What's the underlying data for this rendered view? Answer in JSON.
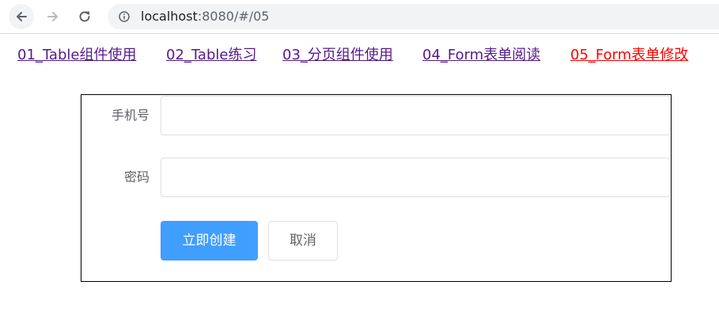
{
  "browser": {
    "url_host": "localhost",
    "url_rest": ":8080/#/05"
  },
  "nav_links": [
    {
      "label": "01_Table组件使用"
    },
    {
      "label": "02_Table练习"
    },
    {
      "label": "03_分页组件使用"
    },
    {
      "label": "04_Form表单阅读"
    },
    {
      "label": "05_Form表单修改",
      "active": true
    }
  ],
  "form": {
    "phone": {
      "label": "手机号",
      "value": ""
    },
    "password": {
      "label": "密码",
      "value": ""
    },
    "submit_label": "立即创建",
    "cancel_label": "取消"
  },
  "colors": {
    "link_visited": "#551a8b",
    "link_active": "#ff0000",
    "primary": "#409eff"
  }
}
